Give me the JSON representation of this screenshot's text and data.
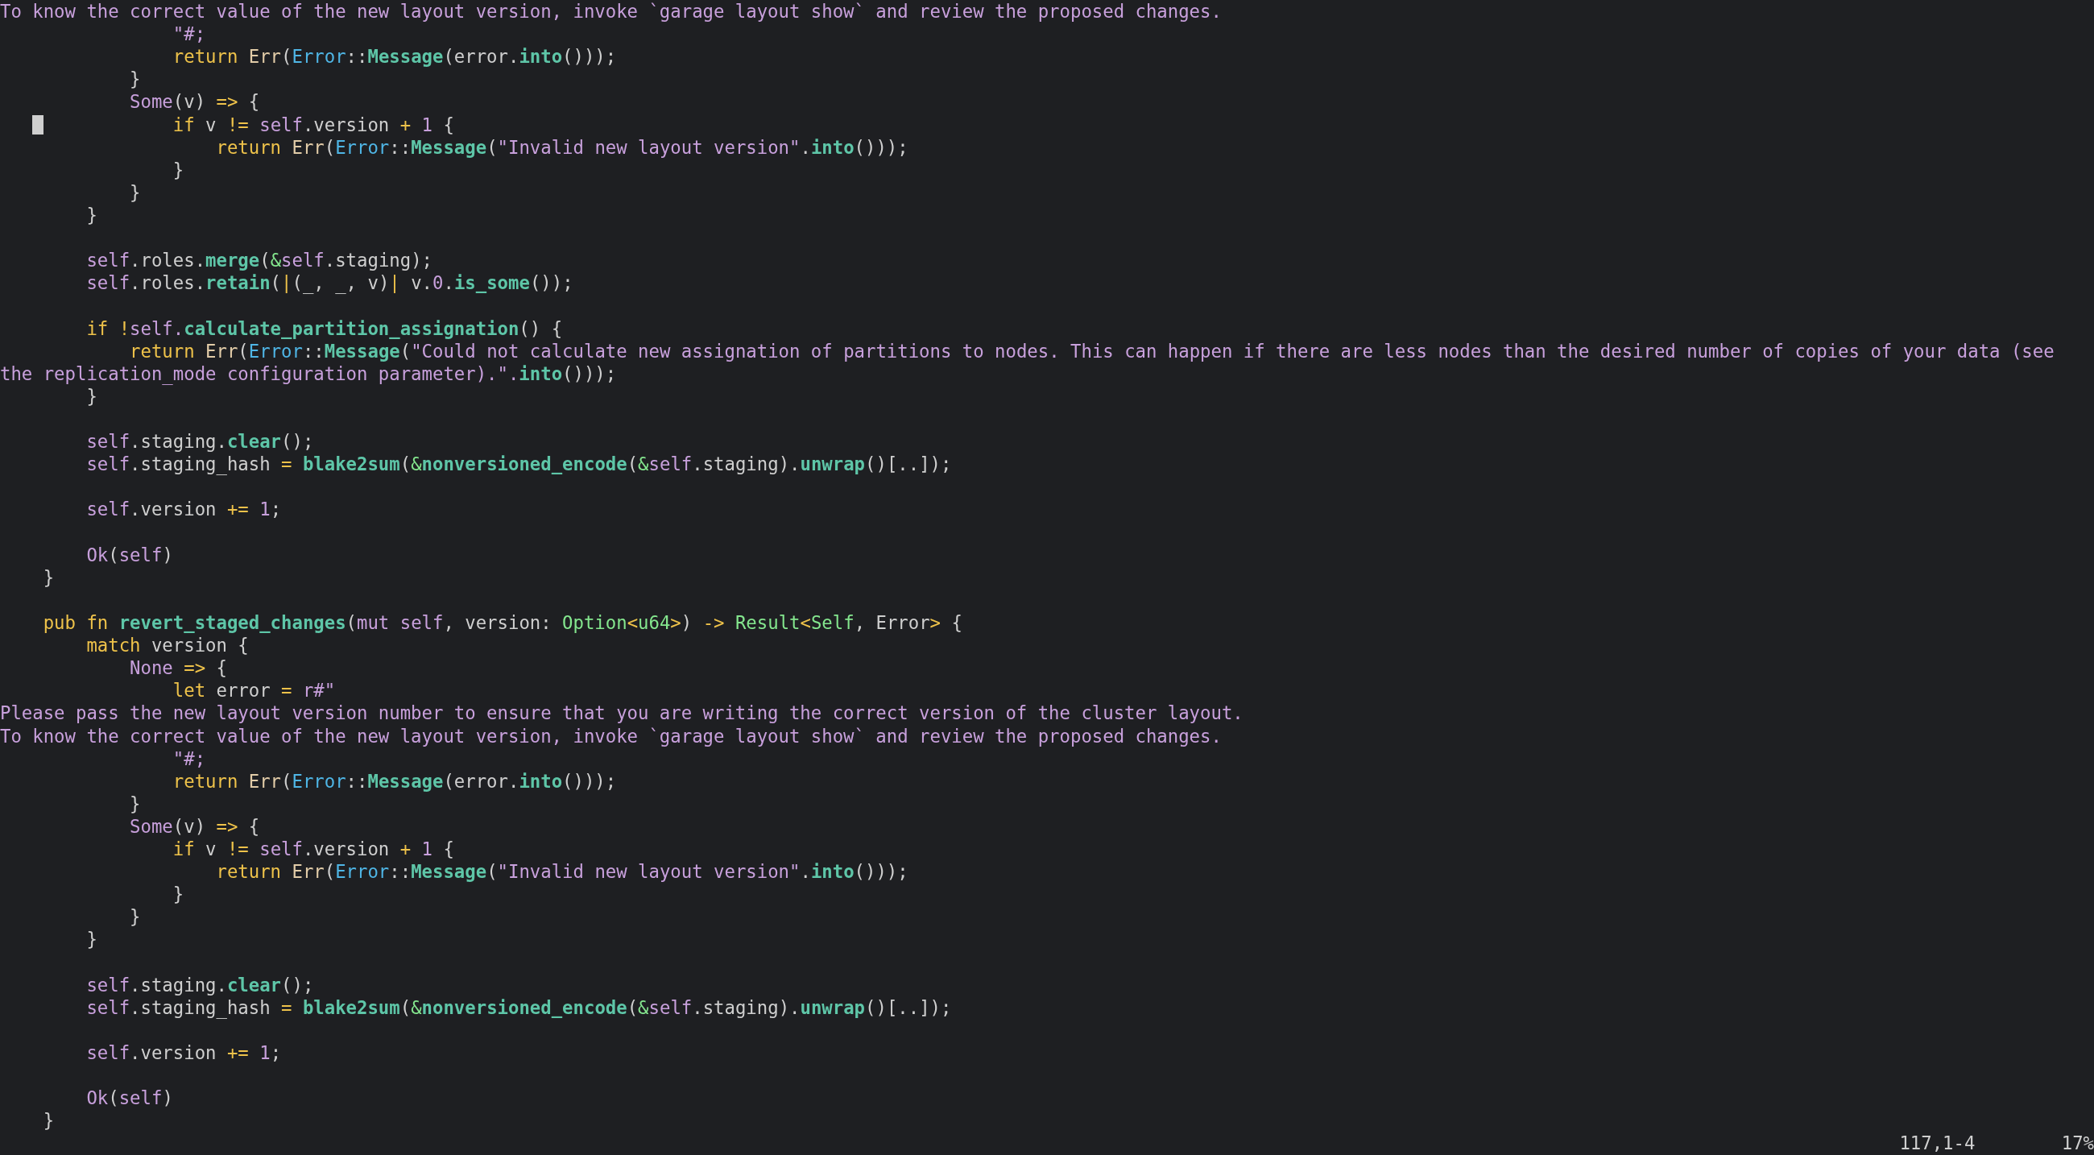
{
  "editor": {
    "lines": [
      {
        "kind": "code",
        "tokens": [
          {
            "kind": "string",
            "text": "To know the correct value of the new layout version, invoke `garage layout show` and review the proposed changes."
          }
        ]
      },
      {
        "kind": "code",
        "tokens": [
          {
            "kind": "string",
            "text": "                \"#;"
          }
        ]
      },
      {
        "kind": "code",
        "tokens": [
          {
            "kind": "keyword",
            "text": "                return "
          },
          {
            "kind": "err",
            "text": "Err"
          },
          {
            "kind": "plain",
            "text": "("
          },
          {
            "kind": "type",
            "text": "Error"
          },
          {
            "kind": "plain",
            "text": "::"
          },
          {
            "kind": "func",
            "text": "Message"
          },
          {
            "kind": "plain",
            "text": "(error."
          },
          {
            "kind": "func",
            "text": "into"
          },
          {
            "kind": "plain",
            "text": "()));"
          }
        ]
      },
      {
        "kind": "code",
        "tokens": [
          {
            "kind": "plain",
            "text": "            }"
          }
        ]
      },
      {
        "kind": "code",
        "tokens": [
          {
            "kind": "string",
            "text": "            Some"
          },
          {
            "kind": "plain",
            "text": "(v) "
          },
          {
            "kind": "keyword",
            "text": "=> "
          },
          {
            "kind": "plain",
            "text": "{"
          }
        ]
      },
      {
        "kind": "code",
        "cursor": true,
        "tokens": [
          {
            "kind": "keyword",
            "text": "                if "
          },
          {
            "kind": "plain",
            "text": "v "
          },
          {
            "kind": "keyword",
            "text": "!= "
          },
          {
            "kind": "string",
            "text": "self"
          },
          {
            "kind": "plain",
            "text": ".version "
          },
          {
            "kind": "keyword",
            "text": "+ "
          },
          {
            "kind": "string",
            "text": "1"
          },
          {
            "kind": "plain",
            "text": " {"
          }
        ]
      },
      {
        "kind": "code",
        "tokens": [
          {
            "kind": "keyword",
            "text": "                    return "
          },
          {
            "kind": "err",
            "text": "Err"
          },
          {
            "kind": "plain",
            "text": "("
          },
          {
            "kind": "type",
            "text": "Error"
          },
          {
            "kind": "plain",
            "text": "::"
          },
          {
            "kind": "func",
            "text": "Message"
          },
          {
            "kind": "plain",
            "text": "("
          },
          {
            "kind": "string",
            "text": "\"Invalid new layout version\""
          },
          {
            "kind": "plain",
            "text": "."
          },
          {
            "kind": "func",
            "text": "into"
          },
          {
            "kind": "plain",
            "text": "()));"
          }
        ]
      },
      {
        "kind": "code",
        "tokens": [
          {
            "kind": "plain",
            "text": "                }"
          }
        ]
      },
      {
        "kind": "code",
        "tokens": [
          {
            "kind": "plain",
            "text": "            }"
          }
        ]
      },
      {
        "kind": "code",
        "tokens": [
          {
            "kind": "plain",
            "text": "        }"
          }
        ]
      },
      {
        "kind": "blank"
      },
      {
        "kind": "code",
        "tokens": [
          {
            "kind": "string",
            "text": "        self"
          },
          {
            "kind": "plain",
            "text": ".roles."
          },
          {
            "kind": "func",
            "text": "merge"
          },
          {
            "kind": "plain",
            "text": "("
          },
          {
            "kind": "green",
            "text": "&"
          },
          {
            "kind": "string",
            "text": "self"
          },
          {
            "kind": "plain",
            "text": ".staging);"
          }
        ]
      },
      {
        "kind": "code",
        "tokens": [
          {
            "kind": "string",
            "text": "        self"
          },
          {
            "kind": "plain",
            "text": ".roles."
          },
          {
            "kind": "func",
            "text": "retain"
          },
          {
            "kind": "plain",
            "text": "("
          },
          {
            "kind": "keyword",
            "text": "|"
          },
          {
            "kind": "plain",
            "text": "(_, _, v)"
          },
          {
            "kind": "keyword",
            "text": "|"
          },
          {
            "kind": "plain",
            "text": " v."
          },
          {
            "kind": "string",
            "text": "0"
          },
          {
            "kind": "plain",
            "text": "."
          },
          {
            "kind": "func",
            "text": "is_some"
          },
          {
            "kind": "plain",
            "text": "());"
          }
        ]
      },
      {
        "kind": "blank"
      },
      {
        "kind": "code",
        "tokens": [
          {
            "kind": "keyword",
            "text": "        if !"
          },
          {
            "kind": "string",
            "text": "self."
          },
          {
            "kind": "func",
            "text": "calculate_partition_assignation"
          },
          {
            "kind": "plain",
            "text": "() {"
          }
        ]
      },
      {
        "kind": "code",
        "tokens": [
          {
            "kind": "keyword",
            "text": "            return "
          },
          {
            "kind": "err",
            "text": "Err"
          },
          {
            "kind": "plain",
            "text": "("
          },
          {
            "kind": "type",
            "text": "Error"
          },
          {
            "kind": "plain",
            "text": "::"
          },
          {
            "kind": "func",
            "text": "Message"
          },
          {
            "kind": "plain",
            "text": "("
          },
          {
            "kind": "string",
            "text": "\"Could not calculate new assignation of partitions to nodes. This can happen if there are less nodes than the desired number of copies of your data (see"
          }
        ]
      },
      {
        "kind": "code",
        "tokens": [
          {
            "kind": "string",
            "text": "the replication_mode configuration parameter).\"."
          },
          {
            "kind": "func",
            "text": "into"
          },
          {
            "kind": "plain",
            "text": "()));"
          }
        ]
      },
      {
        "kind": "code",
        "tokens": [
          {
            "kind": "plain",
            "text": "        }"
          }
        ]
      },
      {
        "kind": "blank"
      },
      {
        "kind": "code",
        "tokens": [
          {
            "kind": "string",
            "text": "        self"
          },
          {
            "kind": "plain",
            "text": ".staging."
          },
          {
            "kind": "func",
            "text": "clear"
          },
          {
            "kind": "plain",
            "text": "();"
          }
        ]
      },
      {
        "kind": "code",
        "tokens": [
          {
            "kind": "string",
            "text": "        self"
          },
          {
            "kind": "plain",
            "text": ".staging_hash "
          },
          {
            "kind": "keyword",
            "text": "= "
          },
          {
            "kind": "func",
            "text": "blake2sum"
          },
          {
            "kind": "plain",
            "text": "("
          },
          {
            "kind": "green",
            "text": "&"
          },
          {
            "kind": "func",
            "text": "nonversioned_encode"
          },
          {
            "kind": "plain",
            "text": "("
          },
          {
            "kind": "green",
            "text": "&"
          },
          {
            "kind": "string",
            "text": "self"
          },
          {
            "kind": "plain",
            "text": ".staging)."
          },
          {
            "kind": "func",
            "text": "unwrap"
          },
          {
            "kind": "plain",
            "text": "()[..]);"
          }
        ]
      },
      {
        "kind": "blank"
      },
      {
        "kind": "code",
        "tokens": [
          {
            "kind": "string",
            "text": "        self"
          },
          {
            "kind": "plain",
            "text": ".version "
          },
          {
            "kind": "keyword",
            "text": "+= "
          },
          {
            "kind": "string",
            "text": "1"
          },
          {
            "kind": "plain",
            "text": ";"
          }
        ]
      },
      {
        "kind": "blank"
      },
      {
        "kind": "code",
        "tokens": [
          {
            "kind": "string",
            "text": "        Ok"
          },
          {
            "kind": "plain",
            "text": "("
          },
          {
            "kind": "string",
            "text": "self"
          },
          {
            "kind": "plain",
            "text": ")"
          }
        ]
      },
      {
        "kind": "code",
        "tokens": [
          {
            "kind": "plain",
            "text": "    }"
          }
        ]
      },
      {
        "kind": "blank"
      },
      {
        "kind": "code",
        "tokens": [
          {
            "kind": "keyword",
            "text": "    pub fn "
          },
          {
            "kind": "func",
            "text": "revert_staged_changes"
          },
          {
            "kind": "plain",
            "text": "("
          },
          {
            "kind": "string",
            "text": "mut self"
          },
          {
            "kind": "plain",
            "text": ", version: "
          },
          {
            "kind": "green",
            "text": "Option"
          },
          {
            "kind": "keyword",
            "text": "<"
          },
          {
            "kind": "green",
            "text": "u64"
          },
          {
            "kind": "keyword",
            "text": ">"
          },
          {
            "kind": "plain",
            "text": ") "
          },
          {
            "kind": "keyword",
            "text": "-> "
          },
          {
            "kind": "green",
            "text": "Result"
          },
          {
            "kind": "keyword",
            "text": "<"
          },
          {
            "kind": "green",
            "text": "Self"
          },
          {
            "kind": "plain",
            "text": ", Error"
          },
          {
            "kind": "keyword",
            "text": ">"
          },
          {
            "kind": "plain",
            "text": " {"
          }
        ]
      },
      {
        "kind": "code",
        "tokens": [
          {
            "kind": "keyword",
            "text": "        match "
          },
          {
            "kind": "plain",
            "text": "version {"
          }
        ]
      },
      {
        "kind": "code",
        "tokens": [
          {
            "kind": "string",
            "text": "            None "
          },
          {
            "kind": "keyword",
            "text": "=> "
          },
          {
            "kind": "plain",
            "text": "{"
          }
        ]
      },
      {
        "kind": "code",
        "tokens": [
          {
            "kind": "keyword",
            "text": "                let "
          },
          {
            "kind": "plain",
            "text": "error "
          },
          {
            "kind": "keyword",
            "text": "= "
          },
          {
            "kind": "string",
            "text": "r#\""
          }
        ]
      },
      {
        "kind": "code",
        "tokens": [
          {
            "kind": "string",
            "text": "Please pass the new layout version number to ensure that you are writing the correct version of the cluster layout."
          }
        ]
      },
      {
        "kind": "code",
        "tokens": [
          {
            "kind": "string",
            "text": "To know the correct value of the new layout version, invoke `garage layout show` and review the proposed changes."
          }
        ]
      },
      {
        "kind": "code",
        "tokens": [
          {
            "kind": "string",
            "text": "                \"#;"
          }
        ]
      },
      {
        "kind": "code",
        "tokens": [
          {
            "kind": "keyword",
            "text": "                return "
          },
          {
            "kind": "err",
            "text": "Err"
          },
          {
            "kind": "plain",
            "text": "("
          },
          {
            "kind": "type",
            "text": "Error"
          },
          {
            "kind": "plain",
            "text": "::"
          },
          {
            "kind": "func",
            "text": "Message"
          },
          {
            "kind": "plain",
            "text": "(error."
          },
          {
            "kind": "func",
            "text": "into"
          },
          {
            "kind": "plain",
            "text": "()));"
          }
        ]
      },
      {
        "kind": "code",
        "tokens": [
          {
            "kind": "plain",
            "text": "            }"
          }
        ]
      },
      {
        "kind": "code",
        "tokens": [
          {
            "kind": "string",
            "text": "            Some"
          },
          {
            "kind": "plain",
            "text": "(v) "
          },
          {
            "kind": "keyword",
            "text": "=> "
          },
          {
            "kind": "plain",
            "text": "{"
          }
        ]
      },
      {
        "kind": "code",
        "tokens": [
          {
            "kind": "keyword",
            "text": "                if "
          },
          {
            "kind": "plain",
            "text": "v "
          },
          {
            "kind": "keyword",
            "text": "!= "
          },
          {
            "kind": "string",
            "text": "self"
          },
          {
            "kind": "plain",
            "text": ".version "
          },
          {
            "kind": "keyword",
            "text": "+ "
          },
          {
            "kind": "string",
            "text": "1"
          },
          {
            "kind": "plain",
            "text": " {"
          }
        ]
      },
      {
        "kind": "code",
        "tokens": [
          {
            "kind": "keyword",
            "text": "                    return "
          },
          {
            "kind": "err",
            "text": "Err"
          },
          {
            "kind": "plain",
            "text": "("
          },
          {
            "kind": "type",
            "text": "Error"
          },
          {
            "kind": "plain",
            "text": "::"
          },
          {
            "kind": "func",
            "text": "Message"
          },
          {
            "kind": "plain",
            "text": "("
          },
          {
            "kind": "string",
            "text": "\"Invalid new layout version\""
          },
          {
            "kind": "plain",
            "text": "."
          },
          {
            "kind": "func",
            "text": "into"
          },
          {
            "kind": "plain",
            "text": "()));"
          }
        ]
      },
      {
        "kind": "code",
        "tokens": [
          {
            "kind": "plain",
            "text": "                }"
          }
        ]
      },
      {
        "kind": "code",
        "tokens": [
          {
            "kind": "plain",
            "text": "            }"
          }
        ]
      },
      {
        "kind": "code",
        "tokens": [
          {
            "kind": "plain",
            "text": "        }"
          }
        ]
      },
      {
        "kind": "blank"
      },
      {
        "kind": "code",
        "tokens": [
          {
            "kind": "string",
            "text": "        self"
          },
          {
            "kind": "plain",
            "text": ".staging."
          },
          {
            "kind": "func",
            "text": "clear"
          },
          {
            "kind": "plain",
            "text": "();"
          }
        ]
      },
      {
        "kind": "code",
        "tokens": [
          {
            "kind": "string",
            "text": "        self"
          },
          {
            "kind": "plain",
            "text": ".staging_hash "
          },
          {
            "kind": "keyword",
            "text": "= "
          },
          {
            "kind": "func",
            "text": "blake2sum"
          },
          {
            "kind": "plain",
            "text": "("
          },
          {
            "kind": "green",
            "text": "&"
          },
          {
            "kind": "func",
            "text": "nonversioned_encode"
          },
          {
            "kind": "plain",
            "text": "("
          },
          {
            "kind": "green",
            "text": "&"
          },
          {
            "kind": "string",
            "text": "self"
          },
          {
            "kind": "plain",
            "text": ".staging)."
          },
          {
            "kind": "func",
            "text": "unwrap"
          },
          {
            "kind": "plain",
            "text": "()[..]);"
          }
        ]
      },
      {
        "kind": "blank"
      },
      {
        "kind": "code",
        "tokens": [
          {
            "kind": "string",
            "text": "        self"
          },
          {
            "kind": "plain",
            "text": ".version "
          },
          {
            "kind": "keyword",
            "text": "+= "
          },
          {
            "kind": "string",
            "text": "1"
          },
          {
            "kind": "plain",
            "text": ";"
          }
        ]
      },
      {
        "kind": "blank"
      },
      {
        "kind": "code",
        "tokens": [
          {
            "kind": "string",
            "text": "        Ok"
          },
          {
            "kind": "plain",
            "text": "("
          },
          {
            "kind": "string",
            "text": "self"
          },
          {
            "kind": "plain",
            "text": ")"
          }
        ]
      },
      {
        "kind": "code",
        "tokens": [
          {
            "kind": "plain",
            "text": "    }"
          }
        ]
      }
    ]
  },
  "status_bar": {
    "cursor_position": "117,1-4",
    "scroll_percent": "17%"
  }
}
